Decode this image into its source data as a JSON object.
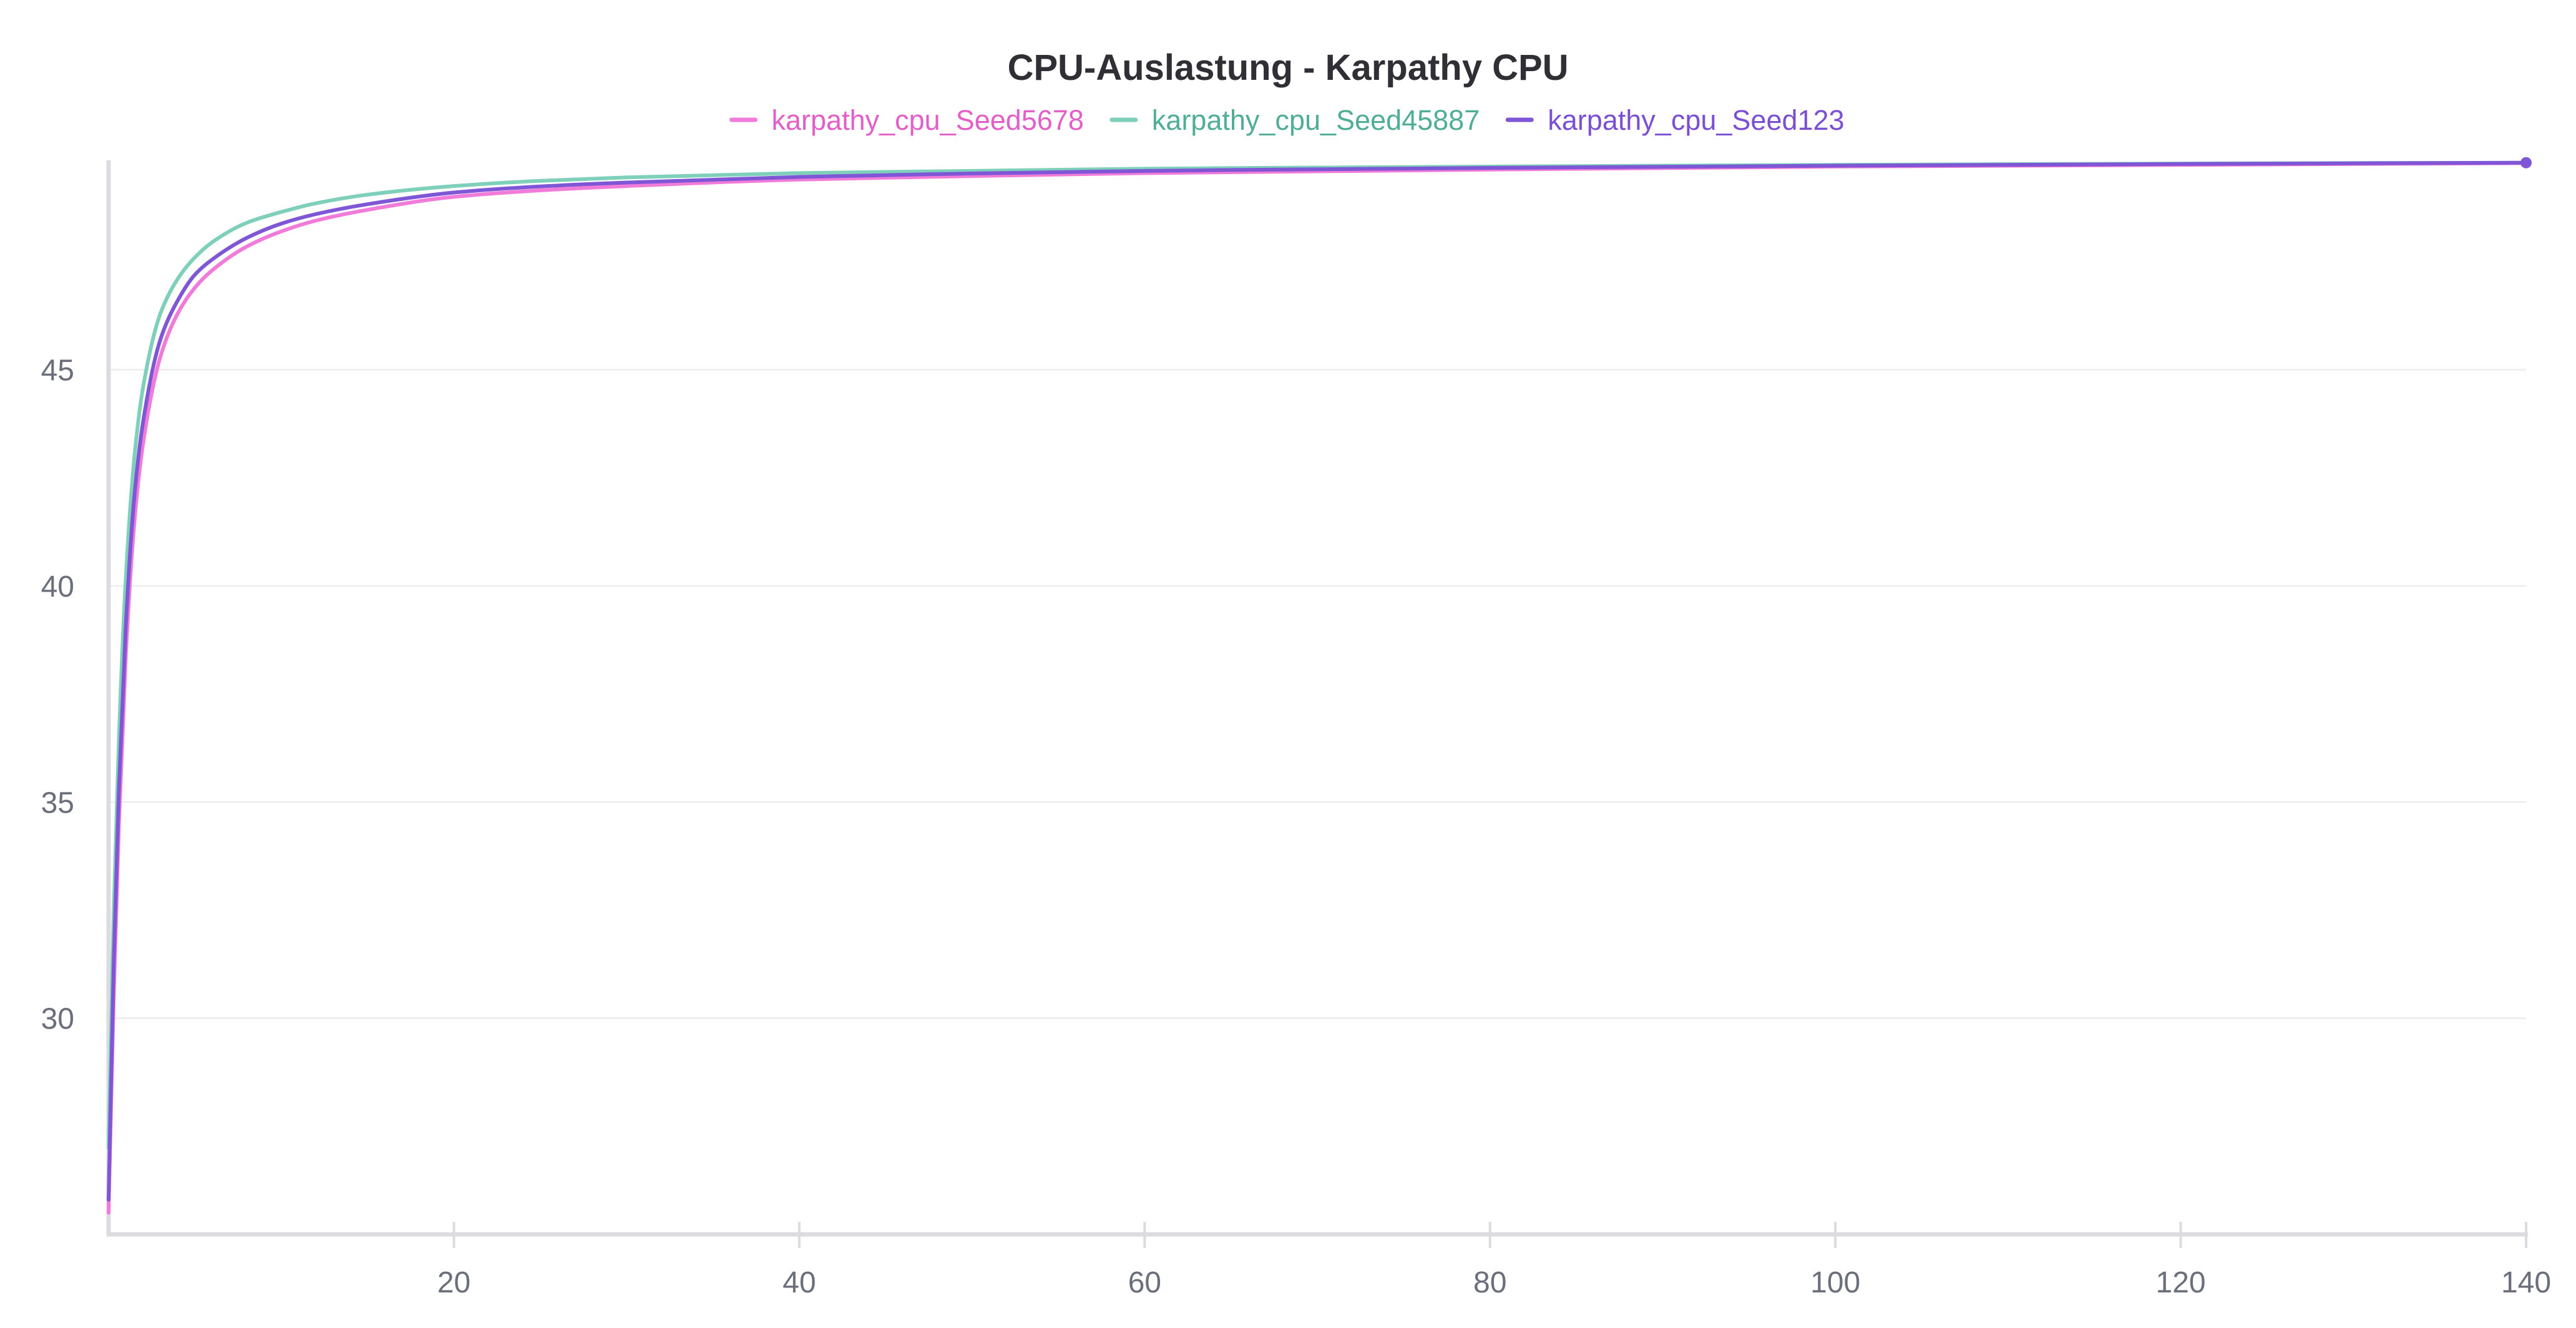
{
  "chart_data": {
    "type": "line",
    "title": "CPU-Auslastung - Karpathy CPU",
    "xlabel": "",
    "ylabel": "",
    "xlim": [
      0,
      140
    ],
    "ylim": [
      25,
      49.8
    ],
    "x_ticks": [
      20,
      40,
      60,
      80,
      100,
      120,
      140
    ],
    "y_ticks": [
      30,
      35,
      40,
      45
    ],
    "grid": "horizontal",
    "legend_position": "top-center",
    "series": [
      {
        "name": "karpathy_cpu_Seed5678",
        "color": "#f07bd9",
        "text_color": "#e25fc8",
        "x": [
          0,
          0.3,
          0.6,
          1,
          1.5,
          2,
          3,
          4,
          5,
          6,
          8,
          10,
          12,
          15,
          20,
          25,
          30,
          40,
          50,
          60,
          80,
          100,
          120,
          140
        ],
        "values": [
          25.5,
          30.5,
          34.5,
          38.4,
          41.5,
          43.3,
          45.3,
          46.3,
          46.9,
          47.3,
          47.85,
          48.2,
          48.45,
          48.7,
          49.0,
          49.15,
          49.25,
          49.4,
          49.48,
          49.55,
          49.63,
          49.7,
          49.74,
          49.78
        ]
      },
      {
        "name": "karpathy_cpu_Seed45887",
        "color": "#7fd0bb",
        "text_color": "#4fae95",
        "x": [
          0,
          0.3,
          0.6,
          1,
          1.5,
          2,
          3,
          4,
          5,
          6,
          8,
          10,
          12,
          15,
          20,
          25,
          30,
          40,
          50,
          60,
          80,
          100,
          120,
          140
        ],
        "values": [
          27.0,
          32.5,
          36.5,
          40.2,
          43.0,
          44.6,
          46.3,
          47.1,
          47.6,
          47.95,
          48.4,
          48.65,
          48.85,
          49.05,
          49.25,
          49.37,
          49.45,
          49.55,
          49.6,
          49.65,
          49.7,
          49.74,
          49.77,
          49.79
        ]
      },
      {
        "name": "karpathy_cpu_Seed123",
        "color": "#7f56d6",
        "text_color": "#7b4fd3",
        "x": [
          0,
          0.3,
          0.6,
          1,
          1.5,
          2,
          3,
          4,
          5,
          6,
          8,
          10,
          12,
          15,
          20,
          25,
          30,
          40,
          50,
          60,
          80,
          100,
          120,
          140
        ],
        "values": [
          25.8,
          31.3,
          35.3,
          39.1,
          42.1,
          43.8,
          45.7,
          46.6,
          47.2,
          47.55,
          48.05,
          48.38,
          48.6,
          48.83,
          49.1,
          49.24,
          49.33,
          49.46,
          49.54,
          49.6,
          49.67,
          49.72,
          49.76,
          49.79
        ]
      }
    ]
  }
}
